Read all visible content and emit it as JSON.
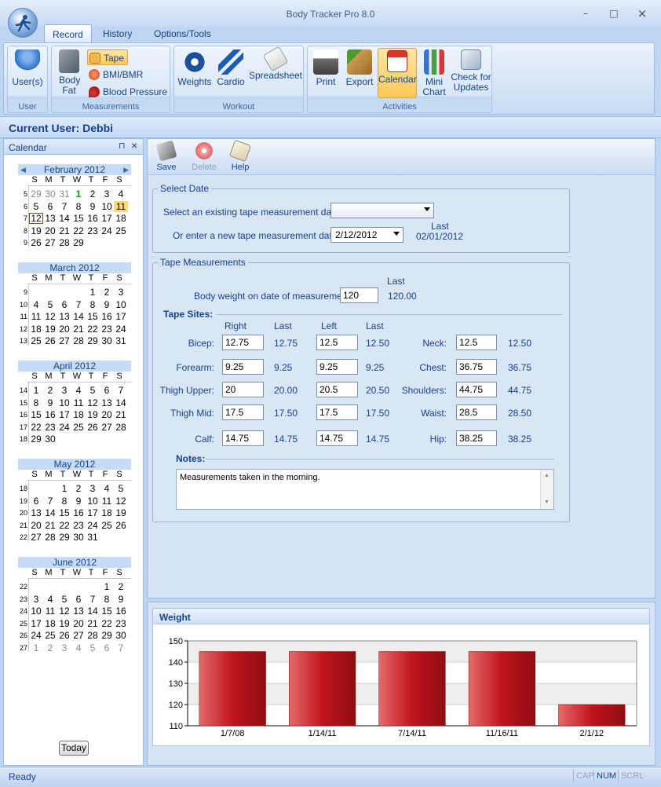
{
  "app": {
    "title": "Body Tracker Pro 8.0",
    "window_controls": [
      "–",
      "□",
      "×"
    ]
  },
  "tabs": [
    {
      "label": "Record",
      "active": true
    },
    {
      "label": "History",
      "active": false
    },
    {
      "label": "Options/Tools",
      "active": false
    }
  ],
  "ribbon": {
    "groups": [
      {
        "caption": "User",
        "buttons": [
          {
            "label": "User(s)",
            "icon": "users-icon"
          }
        ]
      },
      {
        "caption": "Measurements",
        "buttons": [
          {
            "label": "Body Fat",
            "icon": "calculator-icon"
          },
          {
            "label": "Tape",
            "icon": "tape-icon",
            "selected": true
          },
          {
            "label": "BMI/BMR",
            "icon": "heart-icon"
          },
          {
            "label": "Blood Pressure",
            "icon": "blood-drop-icon"
          }
        ]
      },
      {
        "caption": "Workout",
        "buttons": [
          {
            "label": "Weights",
            "icon": "weights-icon"
          },
          {
            "label": "Cardio",
            "icon": "runner-icon"
          },
          {
            "label": "Spreadsheet",
            "icon": "spreadsheet-icon"
          }
        ]
      },
      {
        "caption": "Activities",
        "buttons": [
          {
            "label": "Print",
            "icon": "printer-icon"
          },
          {
            "label": "Export",
            "icon": "export-icon"
          },
          {
            "label": "Calendar",
            "icon": "calendar-icon",
            "selected": true
          },
          {
            "label": "Mini Chart",
            "icon": "mini-chart-icon"
          },
          {
            "label": "Check for Updates",
            "icon": "update-icon"
          }
        ]
      }
    ]
  },
  "current_user": "Current User: Debbi",
  "calendar_panel": {
    "title": "Calendar",
    "pin": "⊓",
    "close": "×",
    "dow": [
      "S",
      "M",
      "T",
      "W",
      "T",
      "F",
      "S"
    ],
    "today_button": "Today",
    "months": [
      {
        "name": "February 2012",
        "weeks": [
          {
            "wk": "5",
            "days": [
              "29",
              "30",
              "31",
              "1",
              "2",
              "3",
              "4"
            ]
          },
          {
            "wk": "6",
            "days": [
              "5",
              "6",
              "7",
              "8",
              "9",
              "10",
              "11"
            ]
          },
          {
            "wk": "7",
            "days": [
              "12",
              "13",
              "14",
              "15",
              "16",
              "17",
              "18"
            ]
          },
          {
            "wk": "8",
            "days": [
              "19",
              "20",
              "21",
              "22",
              "23",
              "24",
              "25"
            ]
          },
          {
            "wk": "9",
            "days": [
              "26",
              "27",
              "28",
              "29",
              "",
              "",
              ""
            ]
          }
        ]
      },
      {
        "name": "March 2012",
        "weeks": [
          {
            "wk": "9",
            "days": [
              "",
              "",
              "",
              "",
              "1",
              "2",
              "3"
            ]
          },
          {
            "wk": "10",
            "days": [
              "4",
              "5",
              "6",
              "7",
              "8",
              "9",
              "10"
            ]
          },
          {
            "wk": "11",
            "days": [
              "11",
              "12",
              "13",
              "14",
              "15",
              "16",
              "17"
            ]
          },
          {
            "wk": "12",
            "days": [
              "18",
              "19",
              "20",
              "21",
              "22",
              "23",
              "24"
            ]
          },
          {
            "wk": "13",
            "days": [
              "25",
              "26",
              "27",
              "28",
              "29",
              "30",
              "31"
            ]
          }
        ]
      },
      {
        "name": "April 2012",
        "weeks": [
          {
            "wk": "14",
            "days": [
              "1",
              "2",
              "3",
              "4",
              "5",
              "6",
              "7"
            ]
          },
          {
            "wk": "15",
            "days": [
              "8",
              "9",
              "10",
              "11",
              "12",
              "13",
              "14"
            ]
          },
          {
            "wk": "16",
            "days": [
              "15",
              "16",
              "17",
              "18",
              "19",
              "20",
              "21"
            ]
          },
          {
            "wk": "17",
            "days": [
              "22",
              "23",
              "24",
              "25",
              "26",
              "27",
              "28"
            ]
          },
          {
            "wk": "18",
            "days": [
              "29",
              "30",
              "",
              "",
              "",
              "",
              ""
            ]
          }
        ]
      },
      {
        "name": "May 2012",
        "weeks": [
          {
            "wk": "18",
            "days": [
              "",
              "",
              "1",
              "2",
              "3",
              "4",
              "5"
            ]
          },
          {
            "wk": "19",
            "days": [
              "6",
              "7",
              "8",
              "9",
              "10",
              "11",
              "12"
            ]
          },
          {
            "wk": "20",
            "days": [
              "13",
              "14",
              "15",
              "16",
              "17",
              "18",
              "19"
            ]
          },
          {
            "wk": "21",
            "days": [
              "20",
              "21",
              "22",
              "23",
              "24",
              "25",
              "26"
            ]
          },
          {
            "wk": "22",
            "days": [
              "27",
              "28",
              "29",
              "30",
              "31",
              "",
              ""
            ]
          }
        ]
      },
      {
        "name": "June 2012",
        "weeks": [
          {
            "wk": "22",
            "days": [
              "",
              "",
              "",
              "",
              "",
              "1",
              "2"
            ]
          },
          {
            "wk": "23",
            "days": [
              "3",
              "4",
              "5",
              "6",
              "7",
              "8",
              "9"
            ]
          },
          {
            "wk": "24",
            "days": [
              "10",
              "11",
              "12",
              "13",
              "14",
              "15",
              "16"
            ]
          },
          {
            "wk": "25",
            "days": [
              "17",
              "18",
              "19",
              "20",
              "21",
              "22",
              "23"
            ]
          },
          {
            "wk": "26",
            "days": [
              "24",
              "25",
              "26",
              "27",
              "28",
              "29",
              "30"
            ]
          },
          {
            "wk": "27",
            "days": [
              "1",
              "2",
              "3",
              "4",
              "5",
              "6",
              "7"
            ]
          }
        ]
      }
    ]
  },
  "toolbar": {
    "save": "Save",
    "delete": "Delete",
    "help": "Help"
  },
  "select_date": {
    "legend": "Select Date",
    "existing_label": "Select an existing tape measurement date:",
    "existing_value": "",
    "new_label": "Or enter a new tape measurement date:",
    "new_value": "2/12/2012",
    "last_label": "Last",
    "last_value": "02/01/2012"
  },
  "tape": {
    "legend": "Tape Measurements",
    "body_weight_label": "Body weight on date of measurement:",
    "body_weight_value": "120",
    "body_weight_last_label": "Last",
    "body_weight_last": "120.00",
    "sites_label": "Tape Sites:",
    "col_right": "Right",
    "col_last1": "Last",
    "col_left": "Left",
    "col_last2": "Last",
    "paired": [
      {
        "label": "Bicep:",
        "right": "12.75",
        "right_last": "12.75",
        "left": "12.5",
        "left_last": "12.50"
      },
      {
        "label": "Forearm:",
        "right": "9.25",
        "right_last": "9.25",
        "left": "9.25",
        "left_last": "9.25"
      },
      {
        "label": "Thigh Upper:",
        "right": "20",
        "right_last": "20.00",
        "left": "20.5",
        "left_last": "20.50"
      },
      {
        "label": "Thigh Mid:",
        "right": "17.5",
        "right_last": "17.50",
        "left": "17.5",
        "left_last": "17.50"
      },
      {
        "label": "Calf:",
        "right": "14.75",
        "right_last": "14.75",
        "left": "14.75",
        "left_last": "14.75"
      }
    ],
    "single": [
      {
        "label": "Neck:",
        "value": "12.5",
        "last": "12.50"
      },
      {
        "label": "Chest:",
        "value": "36.75",
        "last": "36.75"
      },
      {
        "label": "Shoulders:",
        "value": "44.75",
        "last": "44.75"
      },
      {
        "label": "Waist:",
        "value": "28.5",
        "last": "28.50"
      },
      {
        "label": "Hip:",
        "value": "38.25",
        "last": "38.25"
      }
    ],
    "notes_label": "Notes",
    "notes_value": "Measurements taken in the morning."
  },
  "weight_panel": {
    "title": "Weight"
  },
  "chart_data": {
    "type": "bar",
    "categories": [
      "1/7/08",
      "1/14/11",
      "7/14/11",
      "11/16/11",
      "2/1/12"
    ],
    "values": [
      145,
      145,
      145,
      145,
      120
    ],
    "yticks": [
      "110",
      "120",
      "130",
      "140",
      "150"
    ],
    "ylim": [
      110,
      150
    ],
    "bar_color": "#c0141b",
    "grid": true
  },
  "status": {
    "text": "Ready",
    "indicators": [
      "CAP",
      "NUM",
      "SCRL"
    ]
  }
}
